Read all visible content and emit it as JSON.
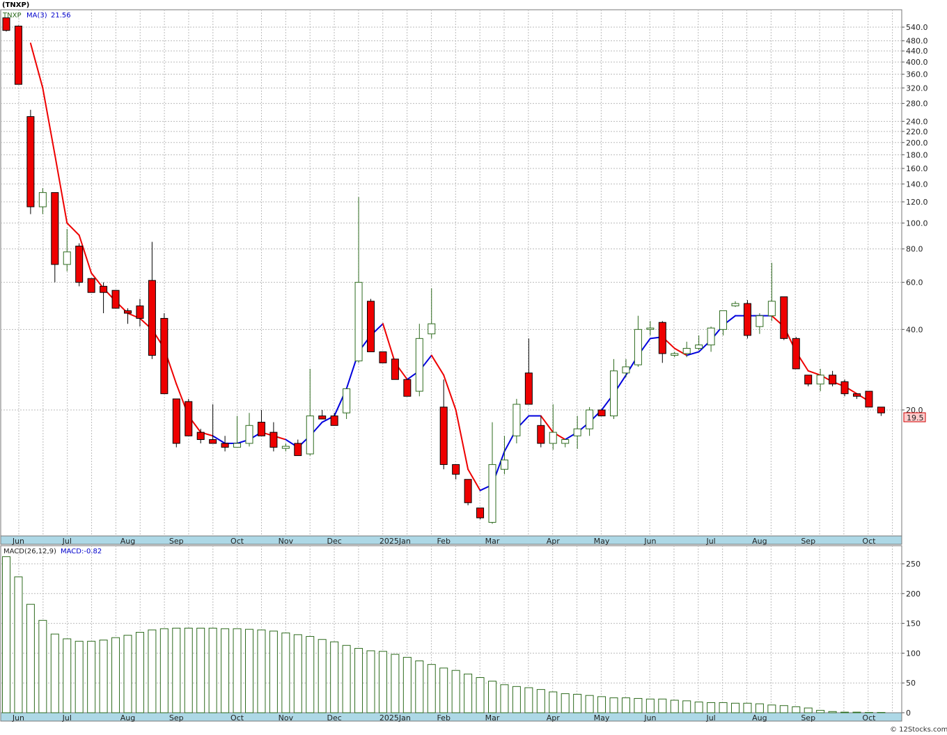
{
  "header": {
    "symbol": "(TNXP)",
    "legend_ticker": "TNXP",
    "legend_ma_label": "MA(3)",
    "legend_ma_value": "21.56",
    "macd_label": "MACD(26,12,9)",
    "macd_value_label": "MACD:-0.82",
    "last_price_tag": "19.5"
  },
  "footer": {
    "watermark": "© 12Stocks.com"
  },
  "colors": {
    "down_candle": "#ee0000",
    "up_candle": "#ffffff",
    "candle_outline": "#000000",
    "wick_up": "#2e6b1e",
    "ma_up": "#0000dd",
    "ma_down": "#ee0000",
    "macd_bar": "#2e6b1e",
    "axis_band": "#add8e6",
    "grid": "#bbbbbb",
    "price_tag_fill": "#ffcccc",
    "price_tag_stroke": "#cc0000"
  },
  "chart_data": [
    {
      "type": "candlestick",
      "title": "(TNXP)",
      "scale": "log",
      "ylim": [
        11,
        590
      ],
      "y_ticks": [
        "540.0",
        "480.0",
        "440.0",
        "400.0",
        "360.0",
        "320.0",
        "280.0",
        "240.0",
        "220.0",
        "200.0",
        "180.0",
        "160.0",
        "140.0",
        "120.0",
        "100.0",
        "80.0",
        "60.0",
        "40.0",
        "20.0"
      ],
      "x_ticks": [
        "Jun",
        "Jul",
        "Aug",
        "Sep",
        "Oct",
        "Nov",
        "Dec",
        "2025Jan",
        "Feb",
        "Mar",
        "Apr",
        "May",
        "Jun",
        "Jul",
        "Aug",
        "Sep",
        "Oct"
      ],
      "x_tick_index": [
        1,
        5,
        10,
        14,
        19,
        23,
        27,
        32,
        36,
        40,
        45,
        49,
        53,
        58,
        62,
        66,
        71
      ],
      "ma_label": "MA(3)",
      "ma_last": 21.56,
      "last_price": 19.5,
      "candles": [
        [
          585,
          585,
          520,
          525
        ],
        [
          545,
          548,
          330,
          330
        ],
        [
          250,
          265,
          108,
          115
        ],
        [
          115,
          135,
          108,
          130
        ],
        [
          130,
          130,
          60,
          70
        ],
        [
          70,
          95,
          66,
          78
        ],
        [
          82,
          84,
          58,
          60
        ],
        [
          62,
          62,
          55,
          55
        ],
        [
          58,
          60,
          46,
          55
        ],
        [
          56,
          56,
          48,
          48
        ],
        [
          47,
          48,
          42,
          46
        ],
        [
          49,
          52,
          41,
          44
        ],
        [
          61,
          85,
          31,
          32
        ],
        [
          44,
          46,
          23,
          23
        ],
        [
          22,
          22,
          14.5,
          15
        ],
        [
          21.5,
          22,
          16,
          16
        ],
        [
          16.5,
          17,
          15,
          15.5
        ],
        [
          15.5,
          21,
          15,
          15
        ],
        [
          15,
          16,
          14,
          14.5
        ],
        [
          14.5,
          19,
          14.5,
          15
        ],
        [
          15,
          19.5,
          14.6,
          17.5
        ],
        [
          18,
          20,
          16,
          16
        ],
        [
          16.5,
          18,
          14,
          14.5
        ],
        [
          14.5,
          15,
          14,
          14.5
        ],
        [
          15,
          15.5,
          13.5,
          13.5
        ],
        [
          13.7,
          28.5,
          13.5,
          19
        ],
        [
          19,
          20,
          18.5,
          18.5
        ],
        [
          19,
          19.5,
          17.5,
          17.5
        ],
        [
          19.5,
          24,
          18.5,
          24
        ],
        [
          30.5,
          125,
          30,
          60
        ],
        [
          51,
          52,
          33,
          33
        ],
        [
          33,
          33,
          30,
          30
        ],
        [
          31,
          31,
          26,
          26
        ],
        [
          26,
          26,
          22.5,
          22.5
        ],
        [
          23.5,
          42,
          22.5,
          37
        ],
        [
          38.5,
          57,
          37,
          42
        ],
        [
          20.5,
          26,
          12,
          12.5
        ],
        [
          12.5,
          12.5,
          11,
          11.5
        ],
        [
          11,
          11,
          8.8,
          9
        ],
        [
          8.6,
          8.6,
          7.8,
          7.9
        ],
        [
          7.6,
          18,
          7.5,
          12.5
        ],
        [
          12,
          16,
          11.5,
          13
        ],
        [
          16,
          22,
          15,
          21
        ],
        [
          27.5,
          37,
          21,
          21
        ],
        [
          17.5,
          19,
          14.5,
          15
        ],
        [
          15,
          21,
          14.2,
          16.5
        ],
        [
          15,
          15.5,
          14.5,
          15.5
        ],
        [
          16,
          19,
          14.3,
          17
        ],
        [
          17,
          20.5,
          16,
          20
        ],
        [
          20,
          20,
          19,
          19
        ],
        [
          19,
          31,
          18.5,
          28
        ],
        [
          27.5,
          31,
          26.5,
          29
        ],
        [
          29.5,
          45,
          29,
          40
        ],
        [
          40,
          43,
          38,
          40.5
        ],
        [
          42.5,
          43,
          30,
          32.5
        ],
        [
          32,
          33,
          31.5,
          32.5
        ],
        [
          32.5,
          36,
          31.5,
          34
        ],
        [
          34,
          38,
          33.5,
          35
        ],
        [
          35,
          41,
          33,
          40.5
        ],
        [
          40,
          47,
          38,
          47
        ],
        [
          49,
          51,
          48.5,
          50
        ],
        [
          50,
          51.5,
          37,
          38
        ],
        [
          41,
          46,
          38.5,
          45
        ],
        [
          45,
          71,
          43,
          51
        ],
        [
          53,
          53,
          36.5,
          37
        ],
        [
          37,
          37.5,
          28.5,
          28.5
        ],
        [
          27,
          27,
          24.5,
          25
        ],
        [
          25,
          28.5,
          23.5,
          27
        ],
        [
          27,
          28,
          24.5,
          25
        ],
        [
          25.5,
          26,
          22.5,
          23
        ],
        [
          23,
          23,
          22,
          22.5
        ],
        [
          23.5,
          23.5,
          20.5,
          20.5
        ],
        [
          20.5,
          20.5,
          19,
          19.5
        ]
      ],
      "ma_values": [
        null,
        null,
        470,
        320,
        180,
        100,
        90,
        65,
        57,
        51,
        46,
        44,
        40,
        34,
        25,
        19,
        16.5,
        16,
        15,
        15,
        15.5,
        16.5,
        16,
        15.5,
        14.5,
        16,
        18,
        19,
        24,
        33,
        38,
        42,
        30,
        26,
        28,
        32,
        27,
        20,
        12,
        10,
        10.5,
        14,
        17,
        19,
        19,
        16.5,
        15.5,
        16.5,
        18,
        20,
        23,
        27,
        32,
        37,
        37.5,
        34,
        32,
        33,
        36.5,
        41.5,
        45,
        45,
        45,
        45,
        41,
        33,
        28,
        27,
        25.5,
        24.5,
        23,
        21.56
      ],
      "ma_trend": [
        "d",
        "d",
        "d",
        "d",
        "d",
        "d",
        "d",
        "d",
        "d",
        "d",
        "d",
        "d",
        "d",
        "d",
        "d",
        "d",
        "d",
        "d",
        "u",
        "u",
        "u",
        "u",
        "d",
        "d",
        "u",
        "u",
        "u",
        "u",
        "u",
        "u",
        "u",
        "u",
        "d",
        "d",
        "u",
        "u",
        "d",
        "d",
        "d",
        "d",
        "u",
        "u",
        "u",
        "u",
        "u",
        "d",
        "d",
        "u",
        "u",
        "u",
        "u",
        "u",
        "u",
        "u",
        "u",
        "d",
        "d",
        "u",
        "u",
        "u",
        "u",
        "u",
        "u",
        "u",
        "d",
        "d",
        "d",
        "d",
        "d",
        "d",
        "d",
        "d",
        "d"
      ]
    },
    {
      "type": "bar",
      "title": "MACD(26,12,9)",
      "ylim": [
        0,
        262
      ],
      "y_ticks": [
        "250",
        "200",
        "150",
        "100",
        "50",
        "0"
      ],
      "x_ticks": [
        "Jun",
        "Jul",
        "Aug",
        "Sep",
        "Oct",
        "Nov",
        "Dec",
        "2025Jan",
        "Feb",
        "Mar",
        "Apr",
        "May",
        "Jun",
        "Jul",
        "Aug",
        "Sep",
        "Oct"
      ],
      "macd_last": -0.82,
      "values": [
        262,
        228,
        182,
        155,
        132,
        124,
        120,
        120,
        122,
        126,
        130,
        135,
        139,
        141,
        142,
        142,
        142,
        142,
        141,
        141,
        140,
        139,
        137,
        134,
        131,
        128,
        123,
        119,
        113,
        108,
        104,
        103,
        98,
        93,
        87,
        81,
        75,
        71,
        65,
        59,
        53,
        47,
        44,
        42,
        39,
        35,
        32,
        31,
        29,
        27,
        25,
        25,
        24,
        23,
        23,
        21,
        20,
        18,
        17,
        17,
        16,
        16,
        15,
        13,
        12,
        10,
        8,
        4,
        2,
        1,
        1,
        0,
        0
      ]
    }
  ]
}
